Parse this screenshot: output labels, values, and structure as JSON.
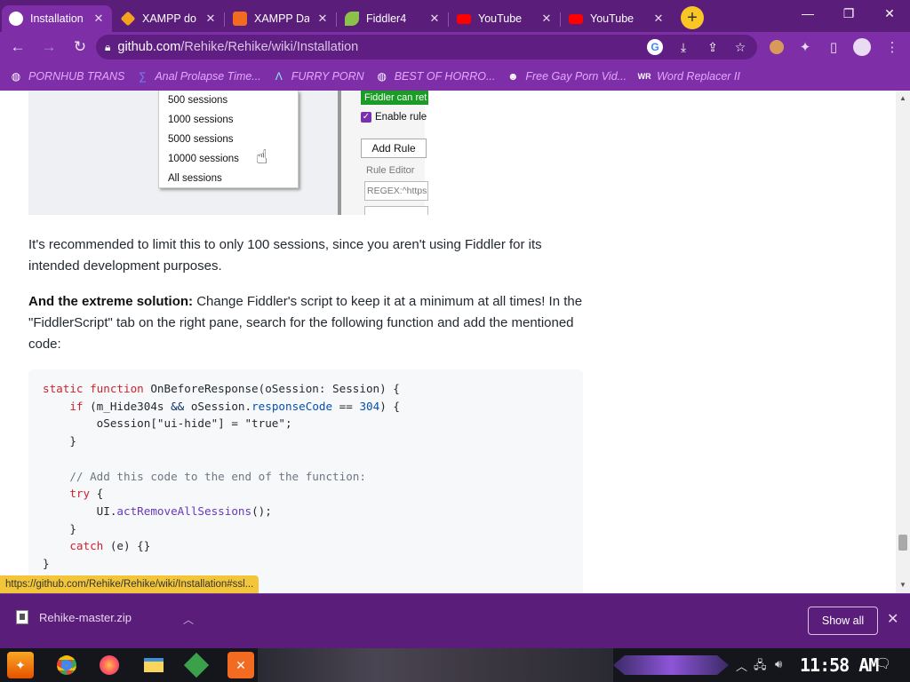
{
  "tabs": [
    {
      "title": "Installation",
      "icon": "github-icon",
      "color": "#ffffff",
      "active": true
    },
    {
      "title": "XAMPP do",
      "icon": "xampp-icon",
      "color": "#f6a11c"
    },
    {
      "title": "XAMPP Da",
      "icon": "xampp-icon",
      "color": "#f36b21"
    },
    {
      "title": "Fiddler4",
      "icon": "fiddler-icon",
      "color": "#8bc34a"
    },
    {
      "title": "YouTube",
      "icon": "youtube-icon",
      "color": "#ff0000"
    },
    {
      "title": "YouTube",
      "icon": "youtube-icon",
      "color": "#ff0000"
    }
  ],
  "new_tab_label": "+",
  "address": {
    "host": "github.com",
    "path": "/Rehike/Rehike/wiki/Installation"
  },
  "bookmarks": [
    {
      "label": "PORNHUB TRANS",
      "icon": "globe-icon"
    },
    {
      "label": "Anal Prolapse Time...",
      "icon": "bookmark-icon"
    },
    {
      "label": "FURRY PORN",
      "icon": "a-logo-icon"
    },
    {
      "label": "BEST OF HORRO...",
      "icon": "globe-icon"
    },
    {
      "label": "Free Gay Porn Vid...",
      "icon": "creature-icon"
    },
    {
      "label": "Word Replacer II",
      "icon": "wr-icon"
    }
  ],
  "screenshot": {
    "sessions": [
      "500 sessions",
      "1000 sessions",
      "5000 sessions",
      "10000 sessions",
      "All sessions"
    ],
    "green_label": "Fiddler can ret",
    "enable_label": "Enable rule",
    "add_rule": "Add Rule",
    "rule_editor": "Rule Editor",
    "regex": "REGEX:^https"
  },
  "article": {
    "para1": "It's recommended to limit this to only 100 sessions, since you aren't using Fiddler for its intended development purposes.",
    "para2_bold": "And the extreme solution:",
    "para2_rest": " Change Fiddler's script to keep it at a minimum at all times! In the \"FiddlerScript\" tab on the right pane, search for the following function and add the mentioned code:"
  },
  "code": {
    "l1_kw": "static function",
    "l1_rest": " OnBeforeResponse(oSession: Session) {",
    "l2_kw": "if",
    "l2_a": " (m_Hide304s ",
    "l2_op": "&&",
    "l2_b": " oSession.",
    "l2_prop": "responseCode",
    "l2_c": " == ",
    "l2_num": "304",
    "l2_d": ") {",
    "l3": "oSession[\"ui-hide\"] = \"true\";",
    "l4": "}",
    "l6": "// Add this code to the end of the function:",
    "l7_kw": "try",
    "l7_rest": " {",
    "l8_a": "UI.",
    "l8_fn": "actRemoveAllSessions",
    "l8_b": "();",
    "l9": "}",
    "l10_kw": "catch",
    "l10_rest": " (e) {}",
    "l11": "}"
  },
  "status_url": "https://github.com/Rehike/Rehike/wiki/Installation#ssl...",
  "download": {
    "file": "Rehike-master.zip",
    "show_all": "Show all"
  },
  "clock": "11:58 AM"
}
